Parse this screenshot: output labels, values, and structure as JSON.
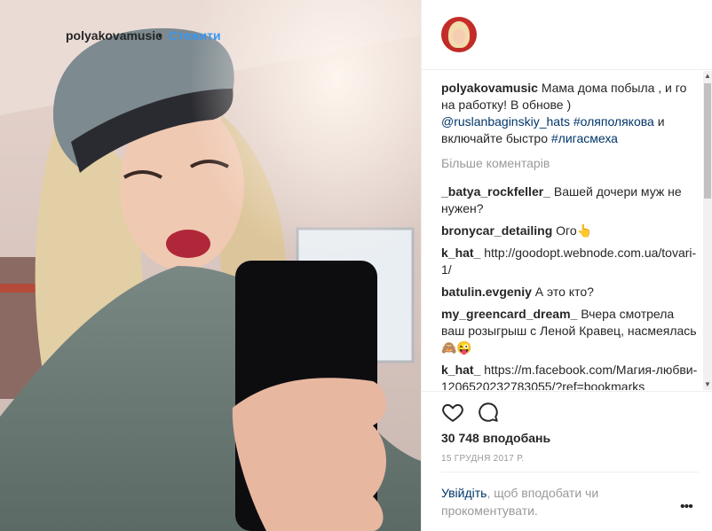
{
  "header": {
    "username": "polyakovamusic",
    "dot": "•",
    "follow_label": "Стежити"
  },
  "caption": {
    "username": "polyakovamusic",
    "text_1": " Мама дома побыла , и го на работку! В обнове ) ",
    "mention": "@ruslanbaginskiy_hats",
    "hashtag_1": " #оляполякова",
    "text_2": " и включайте быстро ",
    "hashtag_2": "#лигасмеха"
  },
  "load_more": "Більше коментарів",
  "comments": [
    {
      "user": "_batya_rockfeller_",
      "text": " Вашей дочери муж не нужен?"
    },
    {
      "user": "bronycar_detailing",
      "text": " Ого👆"
    },
    {
      "user": "k_hat_",
      "text": " http://goodopt.webnode.com.ua/tovari-1/"
    },
    {
      "user": "batulin.evgeniy",
      "text": " А это кто?"
    },
    {
      "user": "my_greencard_dream_",
      "text": " Вчера смотрела ваш розыгрыш с Леной Кравец, насмеялась 🙈😜"
    },
    {
      "user": "k_hat_",
      "text": " https://m.facebook.com/Магия-любви-1206520232783055/?ref=bookmarks"
    }
  ],
  "likes": "30 748 вподобань",
  "date": "15 ГРУДНЯ 2017 Р.",
  "login_prompt": {
    "link": "Увійдіть",
    "text": ", щоб вподобати чи прокоментувати."
  },
  "icons": {
    "like": "heart-icon",
    "comment": "comment-bubble-icon",
    "more": "more-options-icon"
  },
  "more_symbol": "•••"
}
